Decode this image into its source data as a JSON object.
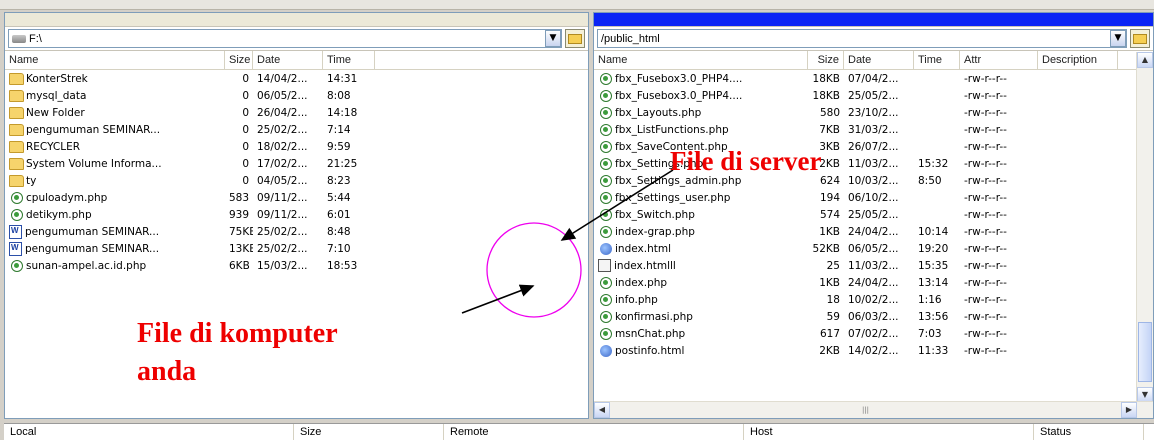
{
  "left": {
    "path": "F:\\",
    "columns": [
      "Name",
      "Size",
      "Date",
      "Time"
    ],
    "rows": [
      {
        "icon": "folder-icon",
        "name": "KonterStrek",
        "size": "0",
        "date": "14/04/2...",
        "time": "14:31"
      },
      {
        "icon": "folder-icon",
        "name": "mysql_data",
        "size": "0",
        "date": "06/05/2...",
        "time": "8:08"
      },
      {
        "icon": "folder-icon",
        "name": "New Folder",
        "size": "0",
        "date": "26/04/2...",
        "time": "14:18"
      },
      {
        "icon": "folder-icon",
        "name": "pengumuman SEMINAR...",
        "size": "0",
        "date": "25/02/2...",
        "time": "7:14"
      },
      {
        "icon": "folder-icon",
        "name": "RECYCLER",
        "size": "0",
        "date": "18/02/2...",
        "time": "9:59"
      },
      {
        "icon": "folder-icon",
        "name": "System Volume Informa...",
        "size": "0",
        "date": "17/02/2...",
        "time": "21:25"
      },
      {
        "icon": "folder-icon",
        "name": "ty",
        "size": "0",
        "date": "04/05/2...",
        "time": "8:23"
      },
      {
        "icon": "php-file-icon",
        "name": "cpuloadym.php",
        "size": "583",
        "date": "09/11/2...",
        "time": "5:44"
      },
      {
        "icon": "php-file-icon",
        "name": "detikym.php",
        "size": "939",
        "date": "09/11/2...",
        "time": "6:01"
      },
      {
        "icon": "word-doc-icon",
        "name": "pengumuman SEMINAR...",
        "size": "75KB",
        "date": "25/02/2...",
        "time": "8:48"
      },
      {
        "icon": "word-doc-icon",
        "name": "pengumuman SEMINAR...",
        "size": "13KB",
        "date": "25/02/2...",
        "time": "7:10"
      },
      {
        "icon": "php-file-icon",
        "name": "sunan-ampel.ac.id.php",
        "size": "6KB",
        "date": "15/03/2...",
        "time": "18:53"
      }
    ]
  },
  "right": {
    "path": "/public_html",
    "columns": [
      "Name",
      "Size",
      "Date",
      "Time",
      "Attr",
      "Description"
    ],
    "rows": [
      {
        "icon": "php-file-icon",
        "name": "fbx_Fusebox3.0_PHP4....",
        "size": "18KB",
        "date": "07/04/2...",
        "time": "",
        "attr": "-rw-r--r--"
      },
      {
        "icon": "php-file-icon",
        "name": "fbx_Fusebox3.0_PHP4....",
        "size": "18KB",
        "date": "25/05/2...",
        "time": "",
        "attr": "-rw-r--r--"
      },
      {
        "icon": "php-file-icon",
        "name": "fbx_Layouts.php",
        "size": "580",
        "date": "23/10/2...",
        "time": "",
        "attr": "-rw-r--r--"
      },
      {
        "icon": "php-file-icon",
        "name": "fbx_ListFunctions.php",
        "size": "7KB",
        "date": "31/03/2...",
        "time": "",
        "attr": "-rw-r--r--"
      },
      {
        "icon": "php-file-icon",
        "name": "fbx_SaveContent.php",
        "size": "3KB",
        "date": "26/07/2...",
        "time": "",
        "attr": "-rw-r--r--"
      },
      {
        "icon": "php-file-icon",
        "name": "fbx_Settings.php",
        "size": "2KB",
        "date": "11/03/2...",
        "time": "15:32",
        "attr": "-rw-r--r--"
      },
      {
        "icon": "php-file-icon",
        "name": "fbx_Settings_admin.php",
        "size": "624",
        "date": "10/03/2...",
        "time": "8:50",
        "attr": "-rw-r--r--"
      },
      {
        "icon": "php-file-icon",
        "name": "fbx_Settings_user.php",
        "size": "194",
        "date": "06/10/2...",
        "time": "",
        "attr": "-rw-r--r--"
      },
      {
        "icon": "php-file-icon",
        "name": "fbx_Switch.php",
        "size": "574",
        "date": "25/05/2...",
        "time": "",
        "attr": "-rw-r--r--"
      },
      {
        "icon": "php-file-icon",
        "name": "index-grap.php",
        "size": "1KB",
        "date": "24/04/2...",
        "time": "10:14",
        "attr": "-rw-r--r--"
      },
      {
        "icon": "html-file-icon",
        "name": "index.html",
        "size": "52KB",
        "date": "06/05/2...",
        "time": "19:20",
        "attr": "-rw-r--r--"
      },
      {
        "icon": "htmlll-file-icon",
        "name": "index.htmlll",
        "size": "25",
        "date": "11/03/2...",
        "time": "15:35",
        "attr": "-rw-r--r--"
      },
      {
        "icon": "php-file-icon",
        "name": "index.php",
        "size": "1KB",
        "date": "24/04/2...",
        "time": "13:14",
        "attr": "-rw-r--r--"
      },
      {
        "icon": "php-file-icon",
        "name": "info.php",
        "size": "18",
        "date": "10/02/2...",
        "time": "1:16",
        "attr": "-rw-r--r--"
      },
      {
        "icon": "php-file-icon",
        "name": "konfirmasi.php",
        "size": "59",
        "date": "06/03/2...",
        "time": "13:56",
        "attr": "-rw-r--r--"
      },
      {
        "icon": "php-file-icon",
        "name": "msnChat.php",
        "size": "617",
        "date": "07/02/2...",
        "time": "7:03",
        "attr": "-rw-r--r--"
      },
      {
        "icon": "html-file-icon",
        "name": "postinfo.html",
        "size": "2KB",
        "date": "14/02/2...",
        "time": "11:33",
        "attr": "-rw-r--r--"
      }
    ]
  },
  "queue": {
    "columns": [
      "Local",
      "Size",
      "Remote",
      "Host",
      "Status"
    ]
  },
  "annotations": {
    "server_label": "File di server",
    "local_label_line1": "File di komputer",
    "local_label_line2": "anda"
  },
  "colors": {
    "active_title": "#0a24f5",
    "annotation_text": "#ee0000",
    "annotation_circle": "#ee00ee"
  }
}
